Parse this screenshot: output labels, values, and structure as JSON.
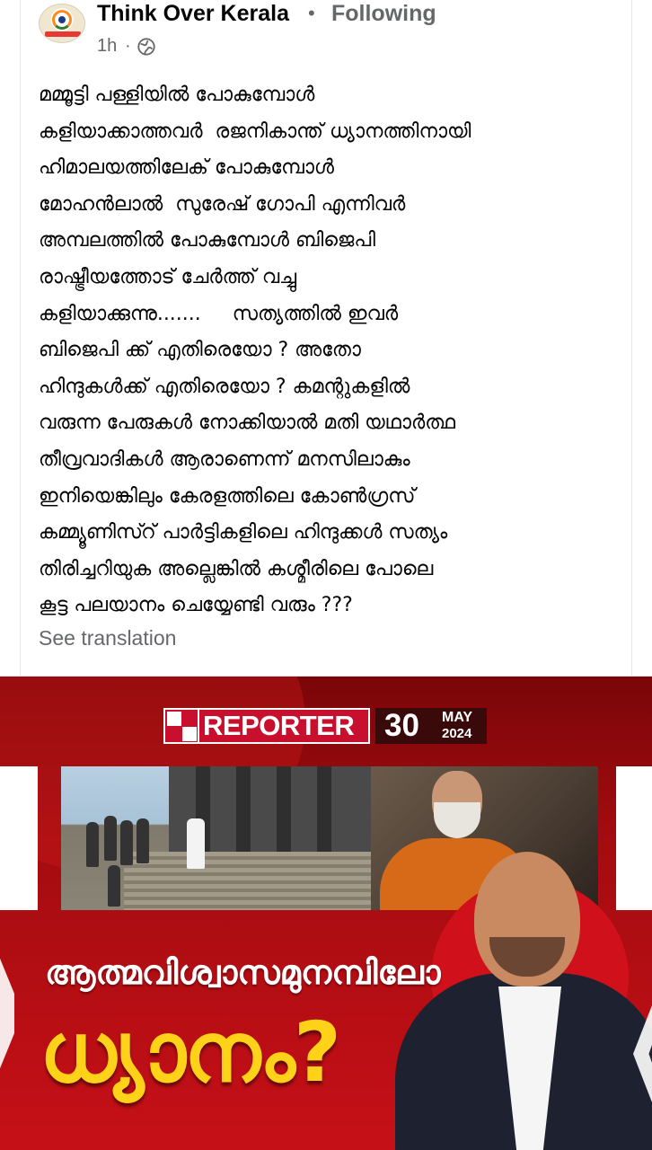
{
  "header": {
    "page_name": "Think Over Kerala",
    "separator": "•",
    "follow_status": "Following",
    "time": "1h",
    "time_separator": "·",
    "privacy_icon": "globe-icon"
  },
  "post": {
    "text": "മമ്മൂട്ടി പള്ളിയിൽ പോകുമ്പോൾ\nകളിയാക്കാത്തവർ  രജനികാന്ത് ധ്യാനത്തിനായി\nഹിമാലയത്തിലേക് പോകുമ്പോൾ\nമോഹൻലാൽ  സുരേഷ് ഗോപി എന്നിവർ\nഅമ്പലത്തിൽ പോകുമ്പോൾ ബിജെപി\nരാഷ്ട്രീയത്തോട് ചേർത്ത് വച്ചു\nകളിയാക്കുന്നു.......     സത്യത്തിൽ ഇവർ\nബിജെപി ക്ക് എതിരെയോ ? അതോ\nഹിന്ദുകൾക്ക് എതിരെയോ ? കമന്റുകളിൽ\nവരുന്ന പേരുകൾ നോക്കിയാൽ മതി യഥാർത്ഥ\nതീവ്രവാദികൾ ആരാണെന്ന് മനസിലാകും\nഇനിയെങ്കിലും കേരളത്തിലെ കോൺഗ്രസ്\nകമ്മ്യൂണിസ്റ് പാർട്ടികളിലെ ഹിന്ദുക്കൾ സത്യം\nതിരിച്ചറിയുക അല്ലെങ്കിൽ കശ്മീരിലെ പോലെ\nകൂട്ട പലയാനം ചെയ്യേണ്ടി വരും ???",
    "see_translation": "See translation"
  },
  "thumbnail": {
    "channel_logo": "REPORTER",
    "date_day": "30",
    "date_month": "MAY",
    "date_year": "2024",
    "headline_line1": "ആത്മവിശ്വാസമുനമ്പിലോ",
    "headline_line2": "ധ്യാനം?",
    "colors": {
      "background": "#b10d12",
      "headline_yellow": "#ffd21a",
      "logo_red": "#c8102e"
    }
  }
}
